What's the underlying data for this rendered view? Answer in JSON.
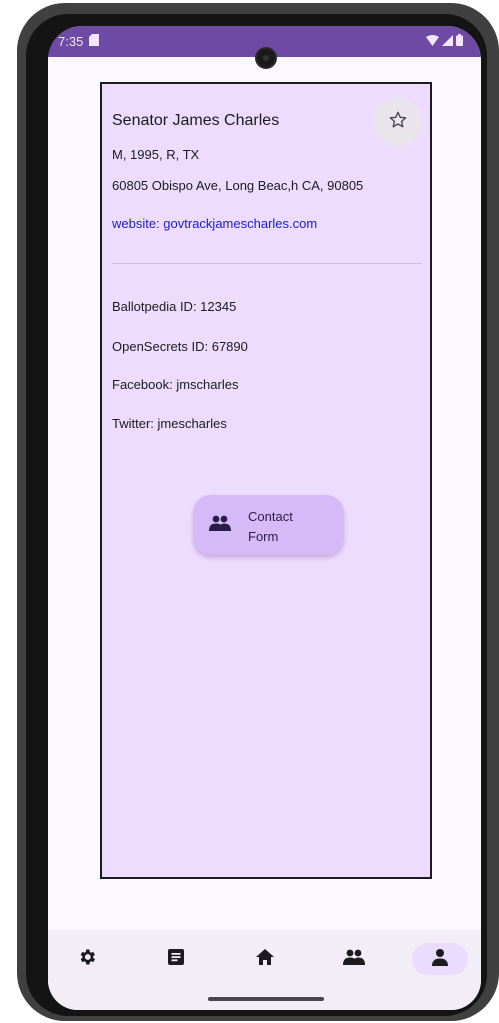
{
  "status_bar": {
    "time": "7:35"
  },
  "representative": {
    "name": "Senator James Charles",
    "details": "M, 1995, R, TX",
    "address": "60805 Obispo Ave, Long Beac,h CA, 90805",
    "website": "website: govtrackjamescharles.com",
    "ballotpedia": "Ballotpedia ID: 12345",
    "opensecrets": "OpenSecrets ID: 67890",
    "facebook": "Facebook: jmscharles",
    "twitter": "Twitter: jmescharles"
  },
  "contact_button": {
    "label_line1": "Contact",
    "label_line2": "Form",
    "icon": "people-icon"
  },
  "bottom_nav": {
    "items": [
      {
        "icon": "gear-icon",
        "active": false
      },
      {
        "icon": "document-icon",
        "active": false
      },
      {
        "icon": "home-icon",
        "active": false
      },
      {
        "icon": "people-icon",
        "active": false
      },
      {
        "icon": "person-icon",
        "active": true
      }
    ]
  },
  "colors": {
    "status_bar": "#6e4aa4",
    "card_background": "#eedcff",
    "link": "#1a1ae6",
    "fab": "#d6baf8",
    "nav_active": "#eadcff"
  }
}
